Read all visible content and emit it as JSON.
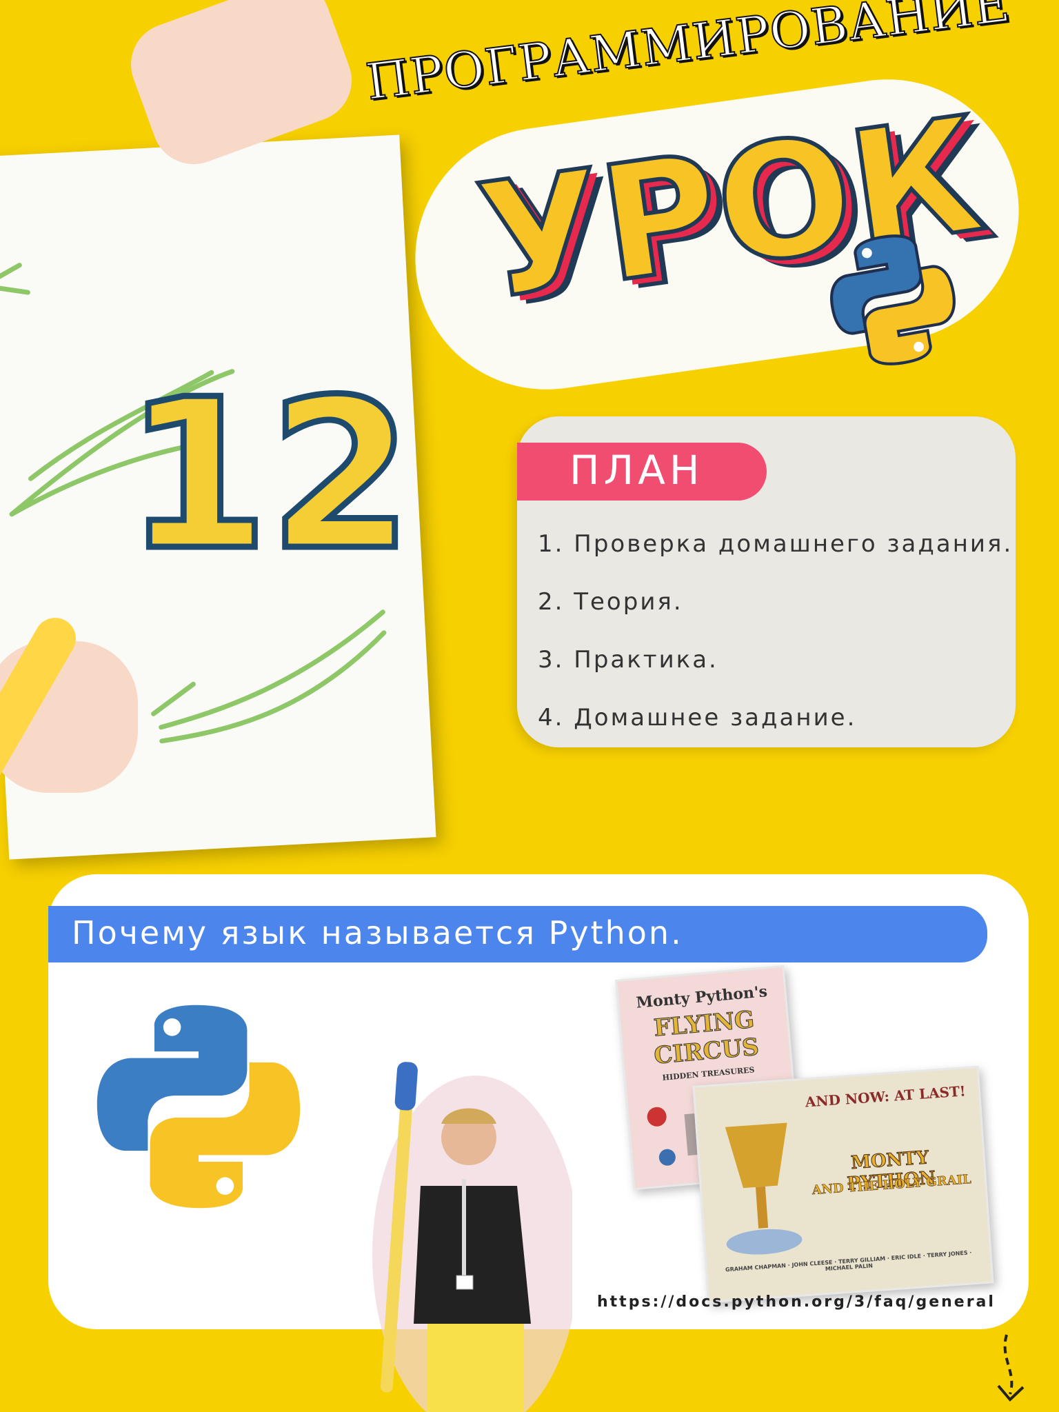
{
  "header": {
    "subject": "ПРОГРАММИРОВАНИЕ",
    "lesson_word": "УРОК",
    "lesson_number": "12"
  },
  "plan": {
    "title": "ПЛАН",
    "items": [
      "1. Проверка домашнего задания.",
      "2. Теория.",
      "3. Практика.",
      "4. Домашнее задание."
    ]
  },
  "why_python": {
    "title": "Почему язык называется Python.",
    "source_link": "https://docs.python.org/3/faq/general"
  },
  "posters": {
    "poster1_lines": [
      "Monty Python's",
      "FLYING",
      "CIRCUS"
    ],
    "poster1_sub": "HIDDEN TREASURES",
    "poster2_top": "AND NOW: AT LAST!",
    "poster2_lines": [
      "MONTY PYTHON",
      "AND THE HOLY GRAIL"
    ],
    "poster2_cast": "GRAHAM CHAPMAN · JOHN CLEESE · TERRY GILLIAM · ERIC IDLE · TERRY JONES · MICHAEL PALIN"
  },
  "colors": {
    "background": "#f7d000",
    "plan_badge": "#f04d71",
    "why_banner": "#4c85ec",
    "python_blue": "#3572b0",
    "python_yellow": "#f7c325"
  },
  "icons": {
    "python_logo": "python-logo-icon",
    "arrow": "down-arrow-icon"
  }
}
